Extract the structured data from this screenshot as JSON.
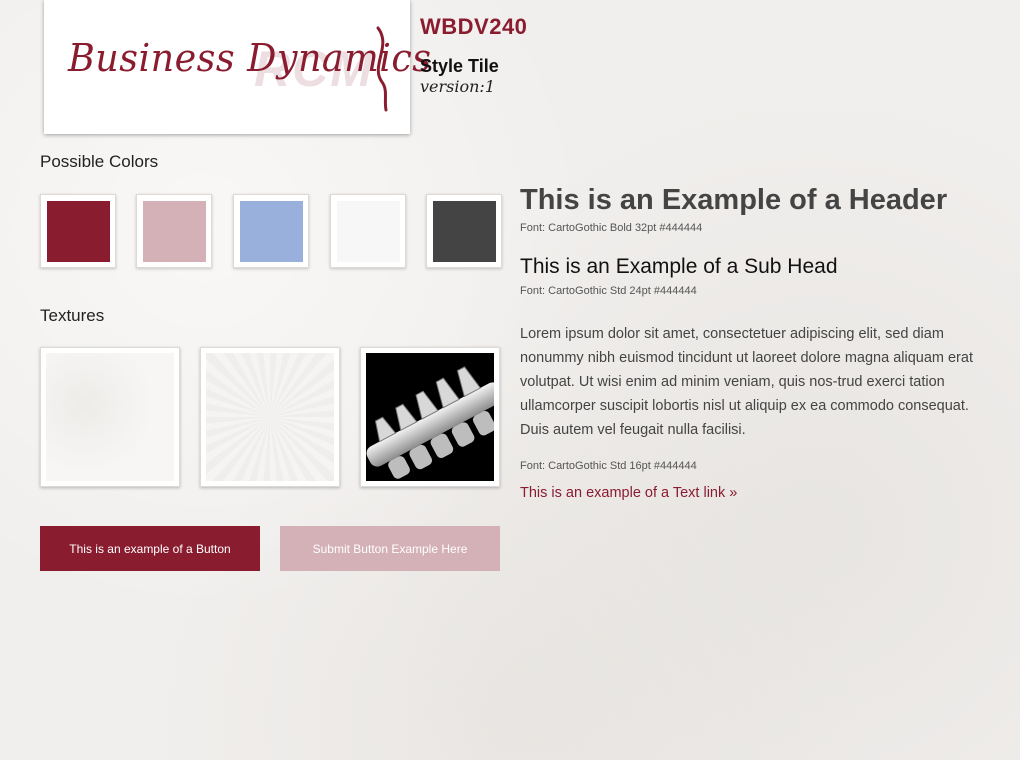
{
  "logo": {
    "text": "Business Dynamics",
    "watermark": "RCM"
  },
  "project": {
    "code": "WBDV240",
    "title": "Style Tile",
    "version": "version:1"
  },
  "colors_section": {
    "title": "Possible Colors",
    "swatches": [
      "#8a1c2f",
      "#d4b0b7",
      "#9ab0dc",
      "#f7f7f7",
      "#444444"
    ]
  },
  "textures_section": {
    "title": "Textures",
    "items": [
      "light-texture",
      "radial-texture",
      "spine-photo"
    ]
  },
  "buttons": {
    "primary_label": "This is an example of a Button",
    "submit_label": "Submit Button Example Here",
    "primary_color": "#8a1c2f",
    "submit_color": "#d4b0b7"
  },
  "typography": {
    "header": "This is an Example of a Header",
    "header_note": "Font: CartoGothic Bold 32pt #444444",
    "subhead": "This is an Example of a Sub Head",
    "subhead_note": "Font: CartoGothic Std 24pt #444444",
    "body": "Lorem ipsum dolor sit amet, consectetuer adipiscing elit, sed diam nonummy nibh euismod tincidunt ut laoreet dolore magna aliquam erat volutpat. Ut wisi enim ad minim veniam, quis nos-trud exerci tation ullamcorper suscipit lobortis nisl ut aliquip ex ea commodo consequat. Duis autem vel feugait nulla facilisi.",
    "body_note": "Font: CartoGothic Std 16pt #444444",
    "link": "This is an example of a Text link »"
  }
}
